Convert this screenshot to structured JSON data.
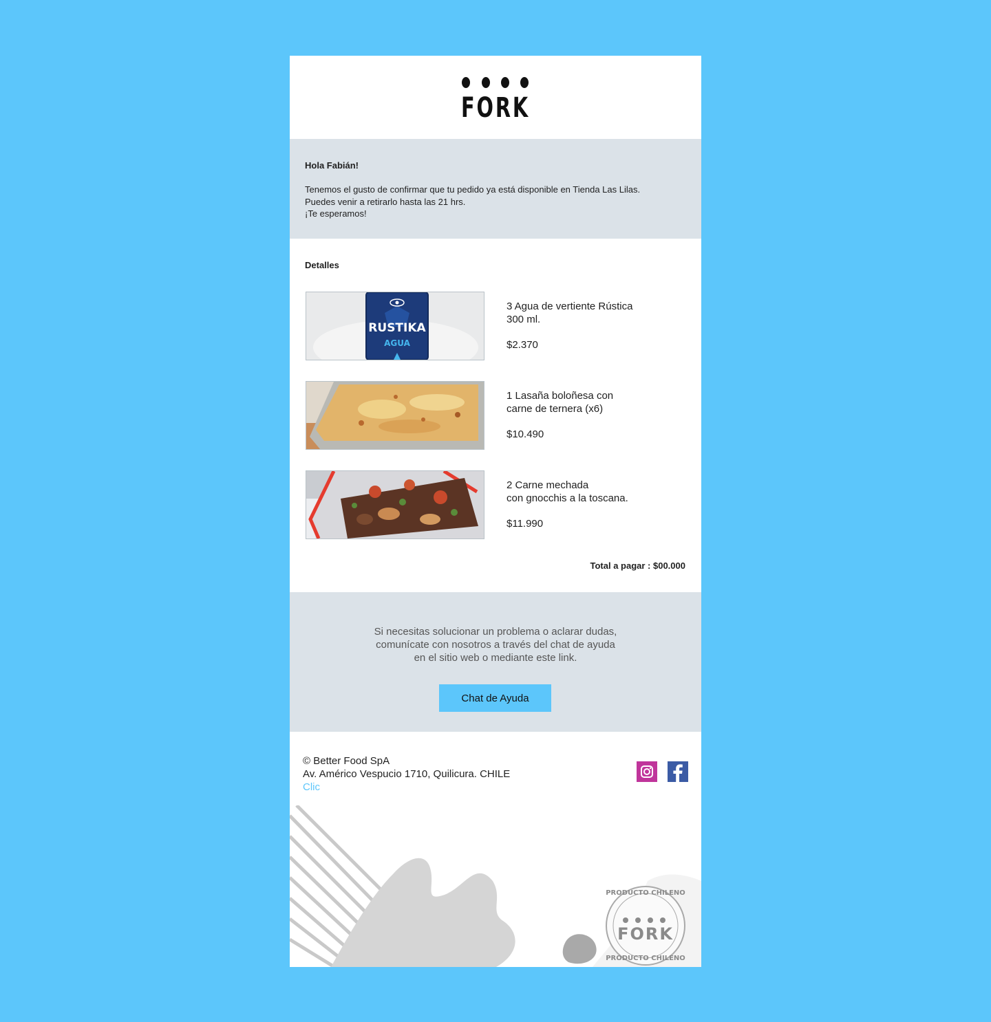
{
  "brand": {
    "name": "FORK"
  },
  "greeting": {
    "hello": "Hola Fabián!",
    "lines": [
      "Tenemos el gusto de confirmar que tu pedido ya está disponible en Tienda Las Lilas.",
      "Puedes venir a retirarlo hasta las 21 hrs.",
      "¡Te esperamos!"
    ]
  },
  "details": {
    "title": "Detalles",
    "items": [
      {
        "name_line1": "3 Agua de vertiente Rústica",
        "name_line2": "300 ml.",
        "price": "$2.370",
        "image_label": "RUSTIKA",
        "image_sublabel": "AGUA"
      },
      {
        "name_line1": "1 Lasaña boloñesa con",
        "name_line2": "carne de ternera (x6)",
        "price": "$10.490"
      },
      {
        "name_line1": "2 Carne mechada",
        "name_line2": "con gnocchis a la toscana.",
        "price": "$11.990"
      }
    ],
    "total": "Total a pagar : $00.000"
  },
  "help": {
    "lines": [
      "Si necesitas solucionar un problema o aclarar dudas,",
      "comunícate con nosotros a través del chat de ayuda",
      "en el sitio web o mediante este link."
    ],
    "button_label": "Chat de Ayuda"
  },
  "footer": {
    "copyright": "© Better Food SpA",
    "address": "Av. Américo Vespucio 1710, Quilicura. CHILE",
    "link": "Clic",
    "social": [
      "instagram-icon",
      "facebook-icon"
    ]
  },
  "stamp": {
    "top_text": "PRODUCTO CHILENO",
    "brand": "FORK",
    "bottom_text": "PRODUCTO CHILENO"
  },
  "colors": {
    "page_bg": "#5cc6fb",
    "panel_bg": "#dbe2e8",
    "button_bg": "#5cc6fb",
    "link": "#5cc6fb",
    "instagram": "#c0359b",
    "facebook": "#3b5ba5"
  }
}
